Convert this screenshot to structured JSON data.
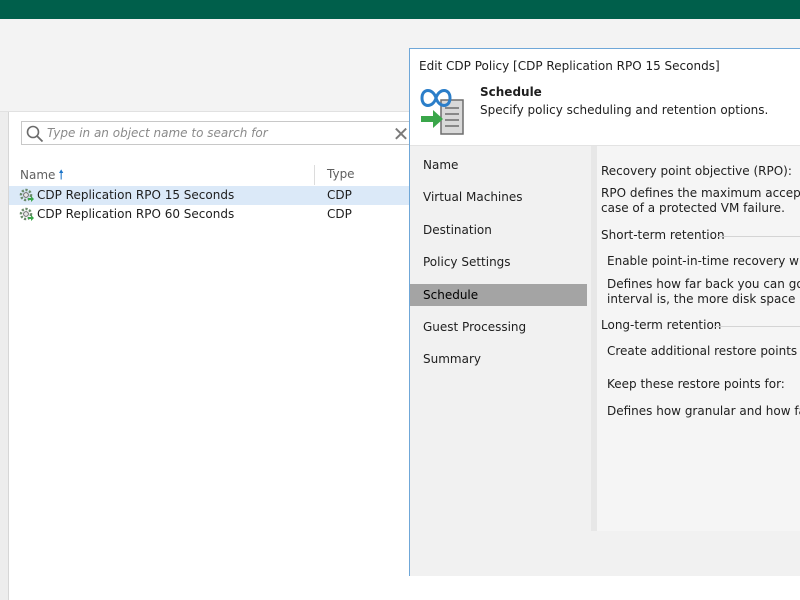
{
  "search": {
    "placeholder": "Type in an object name to search for"
  },
  "columns": {
    "name": "Name",
    "type": "Type"
  },
  "rows": [
    {
      "name": "CDP Replication RPO 15 Seconds",
      "type": "CDP",
      "selected": true
    },
    {
      "name": "CDP Replication RPO 60 Seconds",
      "type": "CDP",
      "selected": false
    }
  ],
  "dialog": {
    "title": "Edit CDP Policy [CDP Replication RPO 15 Seconds]",
    "header_title": "Schedule",
    "header_subtitle": "Specify policy scheduling and retention options.",
    "nav": [
      "Name",
      "Virtual Machines",
      "Destination",
      "Policy Settings",
      "Schedule",
      "Guest Processing",
      "Summary"
    ],
    "active_nav": "Schedule",
    "content": {
      "rpo_label": "Recovery point objective (RPO):",
      "rpo_desc_1": "RPO defines the maximum acceptable",
      "rpo_desc_2": "case of a protected VM failure.",
      "short_term_heading": "Short-term retention",
      "short_term_enable": "Enable point-in-time recovery within:",
      "short_term_desc_1": "Defines how far back you can go from",
      "short_term_desc_2": "interval is, the more disk space is requ",
      "long_term_heading": "Long-term retention",
      "long_term_create": "Create additional restore points every:",
      "long_term_keep": "Keep these restore points for:",
      "long_term_desc": "Defines how granular and how far bac"
    }
  },
  "colors": {
    "topbar": "#005f4b",
    "selection": "#dbe9f8",
    "accent": "#1a73c8",
    "active_nav": "#a4a4a4"
  }
}
